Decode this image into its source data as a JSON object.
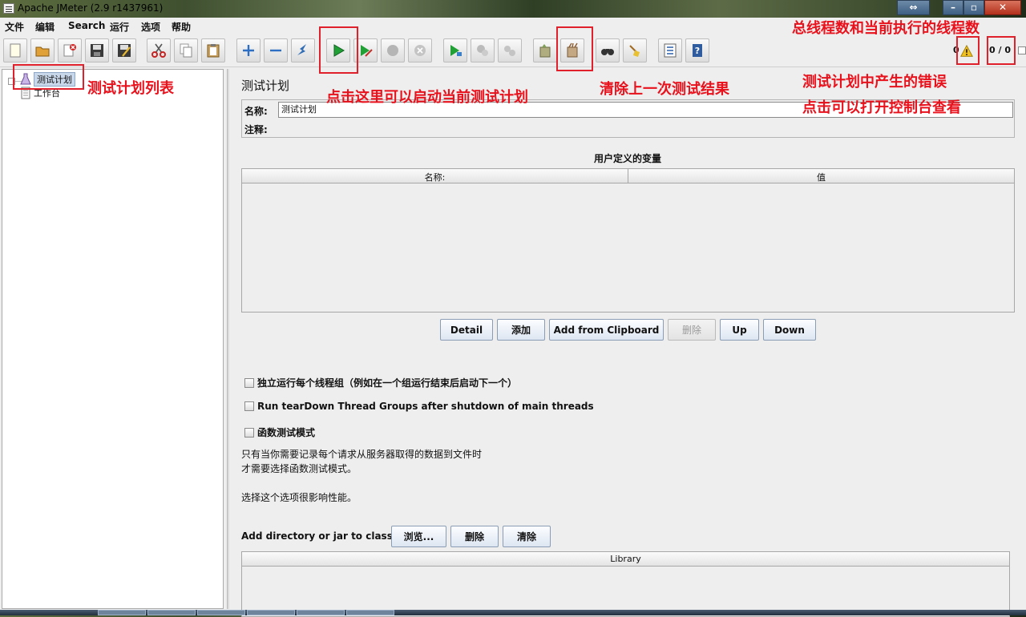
{
  "window": {
    "title": "Apache JMeter (2.9 r1437961)"
  },
  "menu": [
    "文件",
    "编辑",
    "Search",
    "运行",
    "选项",
    "帮助"
  ],
  "toolbar": {
    "error_count": "0",
    "thread_counter": "0 / 0",
    "icons": [
      "new-icon",
      "open-icon",
      "close-file-icon",
      "save-icon",
      "save-as-icon",
      "cut-icon",
      "copy-icon",
      "paste-icon",
      "expand-icon",
      "collapse-icon",
      "toggle-icon",
      "start-icon",
      "start-no-pause-icon",
      "stop-icon",
      "shutdown-icon",
      "remote-start-icon",
      "remote-stop-icon",
      "remote-shutdown-icon",
      "clear-icon",
      "clear-all-icon",
      "search-icon",
      "reset-search-icon",
      "function-helper-icon",
      "help-icon",
      "warning-icon"
    ]
  },
  "tree": {
    "nodes": [
      {
        "label": "测试计划",
        "selected": true
      },
      {
        "label": "工作台",
        "selected": false
      }
    ]
  },
  "panel": {
    "title": "测试计划",
    "name_label": "名称:",
    "name_value": "测试计划",
    "comment_label": "注释:",
    "vars_title": "用户定义的变量",
    "vars_columns": [
      "名称:",
      "值"
    ],
    "buttons": [
      "Detail",
      "添加",
      "Add from Clipboard",
      "删除",
      "Up",
      "Down"
    ],
    "options": [
      {
        "label": "独立运行每个线程组（例如在一个组运行结束后启动下一个）",
        "checked": false
      },
      {
        "label": "Run tearDown Thread Groups after shutdown of main threads",
        "checked": false
      },
      {
        "label": "函数测试模式",
        "checked": false
      }
    ],
    "notes": [
      "只有当你需要记录每个请求从服务器取得的数据到文件时",
      "才需要选择函数测试模式。",
      "选择这个选项很影响性能。"
    ],
    "classpath_label": "Add directory or jar to classpath",
    "classpath_buttons": [
      "浏览...",
      "删除",
      "清除"
    ],
    "library_column": "Library"
  },
  "annotations": {
    "tree_list": "测试计划列表",
    "start": "点击这里可以启动当前测试计划",
    "clear": "清除上一次测试结果",
    "threads": "总线程数和当前执行的线程数",
    "errors_line1": "测试计划中产生的错误",
    "errors_line2": "点击可以打开控制台查看"
  },
  "colors": {
    "annotation_red": "#e8111c",
    "start_green": "#21a035",
    "window_bg": "#eeeeee"
  }
}
